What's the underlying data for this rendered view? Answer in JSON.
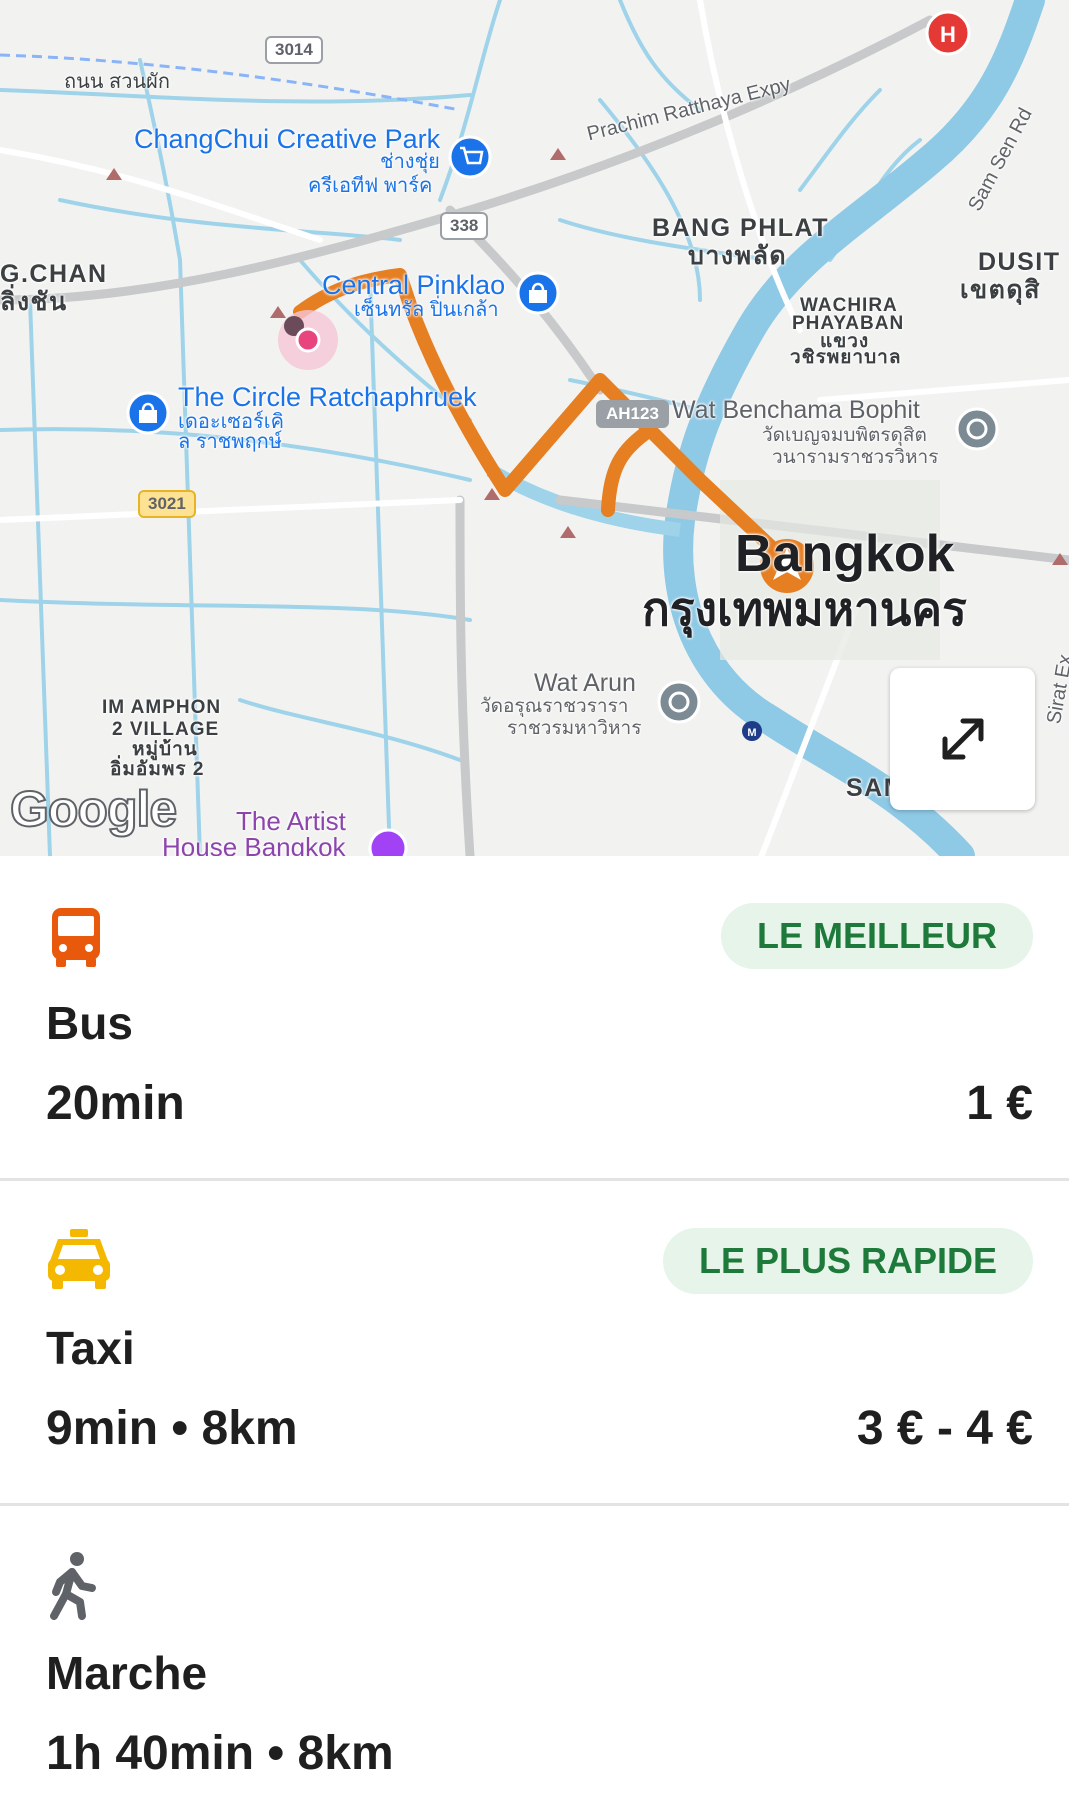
{
  "map": {
    "labels": {
      "road_3014": "3014",
      "thanon_suan_phak": "ถนน สวนผัก",
      "changchui_en": "ChangChui Creative Park",
      "changchui_th1": "ช่างชุ่ย",
      "changchui_th2": "ครีเอทีฟ พาร์ค",
      "prachim_expy": "Prachim Ratthaya Expy",
      "road_338": "338",
      "bang_phlat_en": "BANG PHLAT",
      "bang_phlat_th": "บางพลัด",
      "dusit_en": "DUSIT",
      "dusit_th": "เขตดุสิ",
      "sam_sen_rd": "Sam Sen Rd",
      "chan_en": "G.CHAN",
      "chan_th": "ลิ่งชัน",
      "central_pinklao_en": "Central Pinklao",
      "central_pinklao_th": "เซ็นทรัล ปิ่นเกล้า",
      "wachira1": "WACHIRA",
      "wachira2": "PHAYABAN",
      "wachira3": "แขวง",
      "wachira4": "วชิรพยาบาล",
      "circle_en": "The Circle Ratchaphruek",
      "circle_th1": "เดอะเซอร์เคิ",
      "circle_th2": "ล ราชพฤกษ์",
      "ah123": "AH123",
      "wat_benchama_en": "Wat Benchama Bophit",
      "wat_benchama_th1": "วัดเบญจมบพิตรดุสิต",
      "wat_benchama_th2": "วนารามราชวรวิหาร",
      "road_3021": "3021",
      "bangkok_en": "Bangkok",
      "bangkok_th": "กรุงเทพมหานคร",
      "wat_arun_en": "Wat Arun",
      "wat_arun_th1": "วัดอรุณราชวรารา",
      "wat_arun_th2": "ราชวรมหาวิหาร",
      "im_amphon1": "IM AMPHON",
      "im_amphon2": "2 VILLAGE",
      "im_amphon3": "หมู่บ้าน",
      "im_amphon4": "อิ่มอัมพร 2",
      "artist_house1": "The Artist",
      "artist_house2": "House Bangkok",
      "sam": "SAM",
      "sirat": "Sirat Ex",
      "google": "Google"
    },
    "route_color": "#e67e22",
    "expand_icon": "expand-arrows-icon"
  },
  "options": [
    {
      "icon": "bus-icon",
      "icon_color": "#e8590c",
      "badge": "LE MEILLEUR",
      "name": "Bus",
      "detail": "20min",
      "price": "1 €"
    },
    {
      "icon": "taxi-icon",
      "icon_color": "#f5b800",
      "badge": "LE PLUS RAPIDE",
      "name": "Taxi",
      "detail": "9min • 8km",
      "price": "3 € - 4 €"
    },
    {
      "icon": "walk-icon",
      "icon_color": "#5f6368",
      "name": "Marche",
      "detail": "1h 40min • 8km"
    }
  ]
}
